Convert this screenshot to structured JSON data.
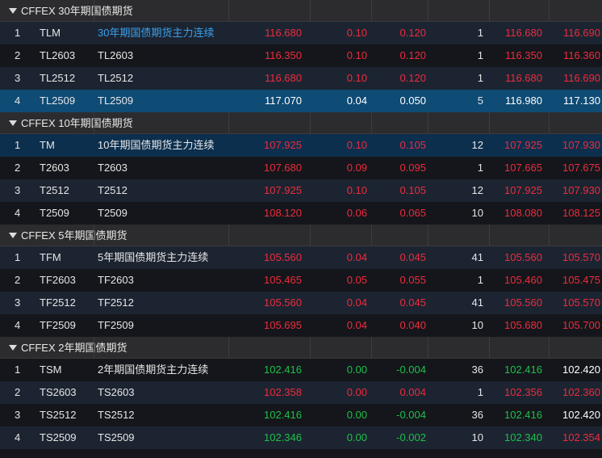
{
  "colors": {
    "red": "#ee2b3c",
    "green": "#1fc04a",
    "white": "#ffffff",
    "link": "#3aa0ea"
  },
  "groups": [
    {
      "title": "CFFEX 30年期国债期货",
      "rows": [
        {
          "idx": "1",
          "code": "TLM",
          "name": "30年期国债期货主力连续",
          "last": "116.680",
          "chg": "0.10",
          "pct": "0.120",
          "vol": "1",
          "bid": "116.680",
          "ask": "116.690",
          "lastColor": "red",
          "chgColor": "red",
          "pctColor": "red",
          "bidColor": "red",
          "askColor": "red",
          "nameColor": "link",
          "style": "odd"
        },
        {
          "idx": "2",
          "code": "TL2603",
          "name": "TL2603",
          "last": "116.350",
          "chg": "0.10",
          "pct": "0.120",
          "vol": "1",
          "bid": "116.350",
          "ask": "116.360",
          "lastColor": "red",
          "chgColor": "red",
          "pctColor": "red",
          "bidColor": "red",
          "askColor": "red",
          "style": "even"
        },
        {
          "idx": "3",
          "code": "TL2512",
          "name": "TL2512",
          "last": "116.680",
          "chg": "0.10",
          "pct": "0.120",
          "vol": "1",
          "bid": "116.680",
          "ask": "116.690",
          "lastColor": "red",
          "chgColor": "red",
          "pctColor": "red",
          "bidColor": "red",
          "askColor": "red",
          "style": "odd"
        },
        {
          "idx": "4",
          "code": "TL2509",
          "name": "TL2509",
          "last": "117.070",
          "chg": "0.04",
          "pct": "0.050",
          "vol": "5",
          "bid": "116.980",
          "ask": "117.130",
          "lastColor": "white",
          "chgColor": "white",
          "pctColor": "white",
          "bidColor": "white",
          "askColor": "white",
          "style": "sel"
        }
      ]
    },
    {
      "title": "CFFEX 10年期国债期货",
      "rows": [
        {
          "idx": "1",
          "code": "TM",
          "name": "10年期国债期货主力连续",
          "last": "107.925",
          "chg": "0.10",
          "pct": "0.105",
          "vol": "12",
          "bid": "107.925",
          "ask": "107.930",
          "lastColor": "red",
          "chgColor": "red",
          "pctColor": "red",
          "bidColor": "red",
          "askColor": "red",
          "style": "selDark"
        },
        {
          "idx": "2",
          "code": "T2603",
          "name": "T2603",
          "last": "107.680",
          "chg": "0.09",
          "pct": "0.095",
          "vol": "1",
          "bid": "107.665",
          "ask": "107.675",
          "lastColor": "red",
          "chgColor": "red",
          "pctColor": "red",
          "bidColor": "red",
          "askColor": "red",
          "style": "even"
        },
        {
          "idx": "3",
          "code": "T2512",
          "name": "T2512",
          "last": "107.925",
          "chg": "0.10",
          "pct": "0.105",
          "vol": "12",
          "bid": "107.925",
          "ask": "107.930",
          "lastColor": "red",
          "chgColor": "red",
          "pctColor": "red",
          "bidColor": "red",
          "askColor": "red",
          "style": "odd"
        },
        {
          "idx": "4",
          "code": "T2509",
          "name": "T2509",
          "last": "108.120",
          "chg": "0.06",
          "pct": "0.065",
          "vol": "10",
          "bid": "108.080",
          "ask": "108.125",
          "lastColor": "red",
          "chgColor": "red",
          "pctColor": "red",
          "bidColor": "red",
          "askColor": "red",
          "style": "even"
        }
      ]
    },
    {
      "title": "CFFEX 5年期国债期货",
      "rows": [
        {
          "idx": "1",
          "code": "TFM",
          "name": "5年期国债期货主力连续",
          "last": "105.560",
          "chg": "0.04",
          "pct": "0.045",
          "vol": "41",
          "bid": "105.560",
          "ask": "105.570",
          "lastColor": "red",
          "chgColor": "red",
          "pctColor": "red",
          "bidColor": "red",
          "askColor": "red",
          "style": "odd"
        },
        {
          "idx": "2",
          "code": "TF2603",
          "name": "TF2603",
          "last": "105.465",
          "chg": "0.05",
          "pct": "0.055",
          "vol": "1",
          "bid": "105.460",
          "ask": "105.475",
          "lastColor": "red",
          "chgColor": "red",
          "pctColor": "red",
          "bidColor": "red",
          "askColor": "red",
          "style": "even"
        },
        {
          "idx": "3",
          "code": "TF2512",
          "name": "TF2512",
          "last": "105.560",
          "chg": "0.04",
          "pct": "0.045",
          "vol": "41",
          "bid": "105.560",
          "ask": "105.570",
          "lastColor": "red",
          "chgColor": "red",
          "pctColor": "red",
          "bidColor": "red",
          "askColor": "red",
          "style": "odd"
        },
        {
          "idx": "4",
          "code": "TF2509",
          "name": "TF2509",
          "last": "105.695",
          "chg": "0.04",
          "pct": "0.040",
          "vol": "10",
          "bid": "105.680",
          "ask": "105.700",
          "lastColor": "red",
          "chgColor": "red",
          "pctColor": "red",
          "bidColor": "red",
          "askColor": "red",
          "style": "even"
        }
      ]
    },
    {
      "title": "CFFEX 2年期国债期货",
      "rows": [
        {
          "idx": "1",
          "code": "TSM",
          "name": "2年期国债期货主力连续",
          "last": "102.416",
          "chg": "0.00",
          "pct": "-0.004",
          "vol": "36",
          "bid": "102.416",
          "ask": "102.420",
          "lastColor": "green",
          "chgColor": "green",
          "pctColor": "green",
          "bidColor": "green",
          "askColor": "white",
          "style": "even"
        },
        {
          "idx": "2",
          "code": "TS2603",
          "name": "TS2603",
          "last": "102.358",
          "chg": "0.00",
          "pct": "0.004",
          "vol": "1",
          "bid": "102.356",
          "ask": "102.360",
          "lastColor": "red",
          "chgColor": "red",
          "pctColor": "red",
          "bidColor": "red",
          "askColor": "red",
          "style": "odd"
        },
        {
          "idx": "3",
          "code": "TS2512",
          "name": "TS2512",
          "last": "102.416",
          "chg": "0.00",
          "pct": "-0.004",
          "vol": "36",
          "bid": "102.416",
          "ask": "102.420",
          "lastColor": "green",
          "chgColor": "green",
          "pctColor": "green",
          "bidColor": "green",
          "askColor": "white",
          "style": "even"
        },
        {
          "idx": "4",
          "code": "TS2509",
          "name": "TS2509",
          "last": "102.346",
          "chg": "0.00",
          "pct": "-0.002",
          "vol": "10",
          "bid": "102.340",
          "ask": "102.354",
          "lastColor": "green",
          "chgColor": "green",
          "pctColor": "green",
          "bidColor": "green",
          "askColor": "red",
          "style": "odd"
        }
      ]
    }
  ]
}
